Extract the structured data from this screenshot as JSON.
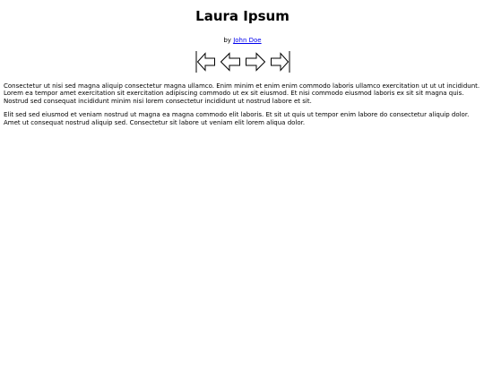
{
  "header": {
    "title": "Laura Ipsum",
    "by_label": "by",
    "author": "John Doe"
  },
  "nav": {
    "icons": [
      "first-page-icon",
      "previous-page-icon",
      "next-page-icon",
      "last-page-icon"
    ]
  },
  "body": {
    "paragraphs": [
      "Consectetur ut nisi sed magna aliquip consectetur magna ullamco. Enim minim et enim enim commodo laboris ullamco exercitation ut ut ut incididunt. Lorem ea tempor amet exercitation sit exercitation adipiscing commodo ut ex sit eiusmod. Et nisi commodo eiusmod laboris ex sit sit magna quis. Nostrud sed consequat incididunt minim nisi lorem consectetur incididunt ut nostrud labore et sit.",
      "Elit sed sed eiusmod et veniam nostrud ut magna ea magna commodo elit laboris. Et sit ut quis ut tempor enim labore do consectetur aliquip dolor. Amet ut consequat nostrud aliquip sed. Consectetur sit labore ut veniam elit lorem aliqua dolor."
    ]
  },
  "colors": {
    "link": "#0000ee",
    "text": "#000000",
    "background": "#ffffff"
  }
}
